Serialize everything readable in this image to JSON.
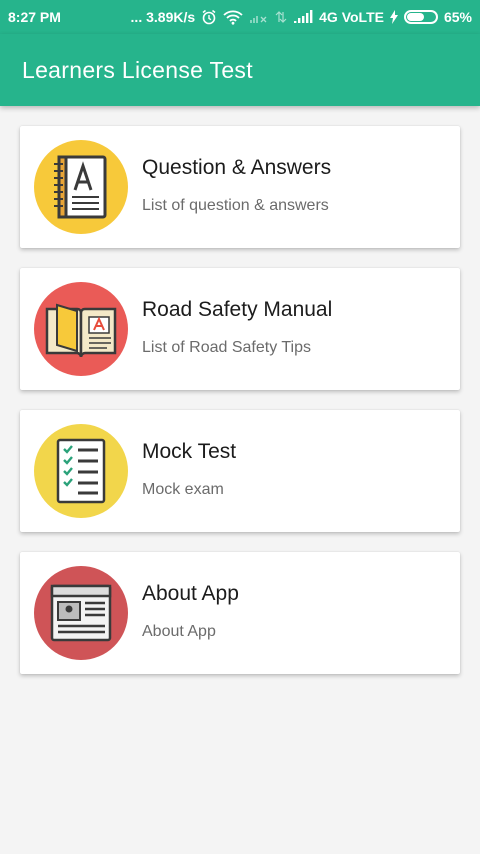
{
  "status_bar": {
    "time": "8:27 PM",
    "speed": "... 3.89K/s",
    "network": "4G VoLTE",
    "battery_percent": "65%",
    "battery_level": 0.65
  },
  "app_bar": {
    "title": "Learners License Test"
  },
  "menu": [
    {
      "title": "Question & Answers",
      "subtitle": "List of question & answers",
      "icon": "notebook-icon",
      "icon_bg": "#f7c93a"
    },
    {
      "title": "Road Safety Manual",
      "subtitle": "List of Road Safety Tips",
      "icon": "book-icon",
      "icon_bg": "#ea5b57"
    },
    {
      "title": "Mock Test",
      "subtitle": "Mock exam",
      "icon": "checklist-icon",
      "icon_bg": "#f2d64b"
    },
    {
      "title": "About App",
      "subtitle": "About App",
      "icon": "newspaper-icon",
      "icon_bg": "#cf5457"
    }
  ],
  "colors": {
    "primary": "#26b48c",
    "background": "#f4f4f4"
  }
}
